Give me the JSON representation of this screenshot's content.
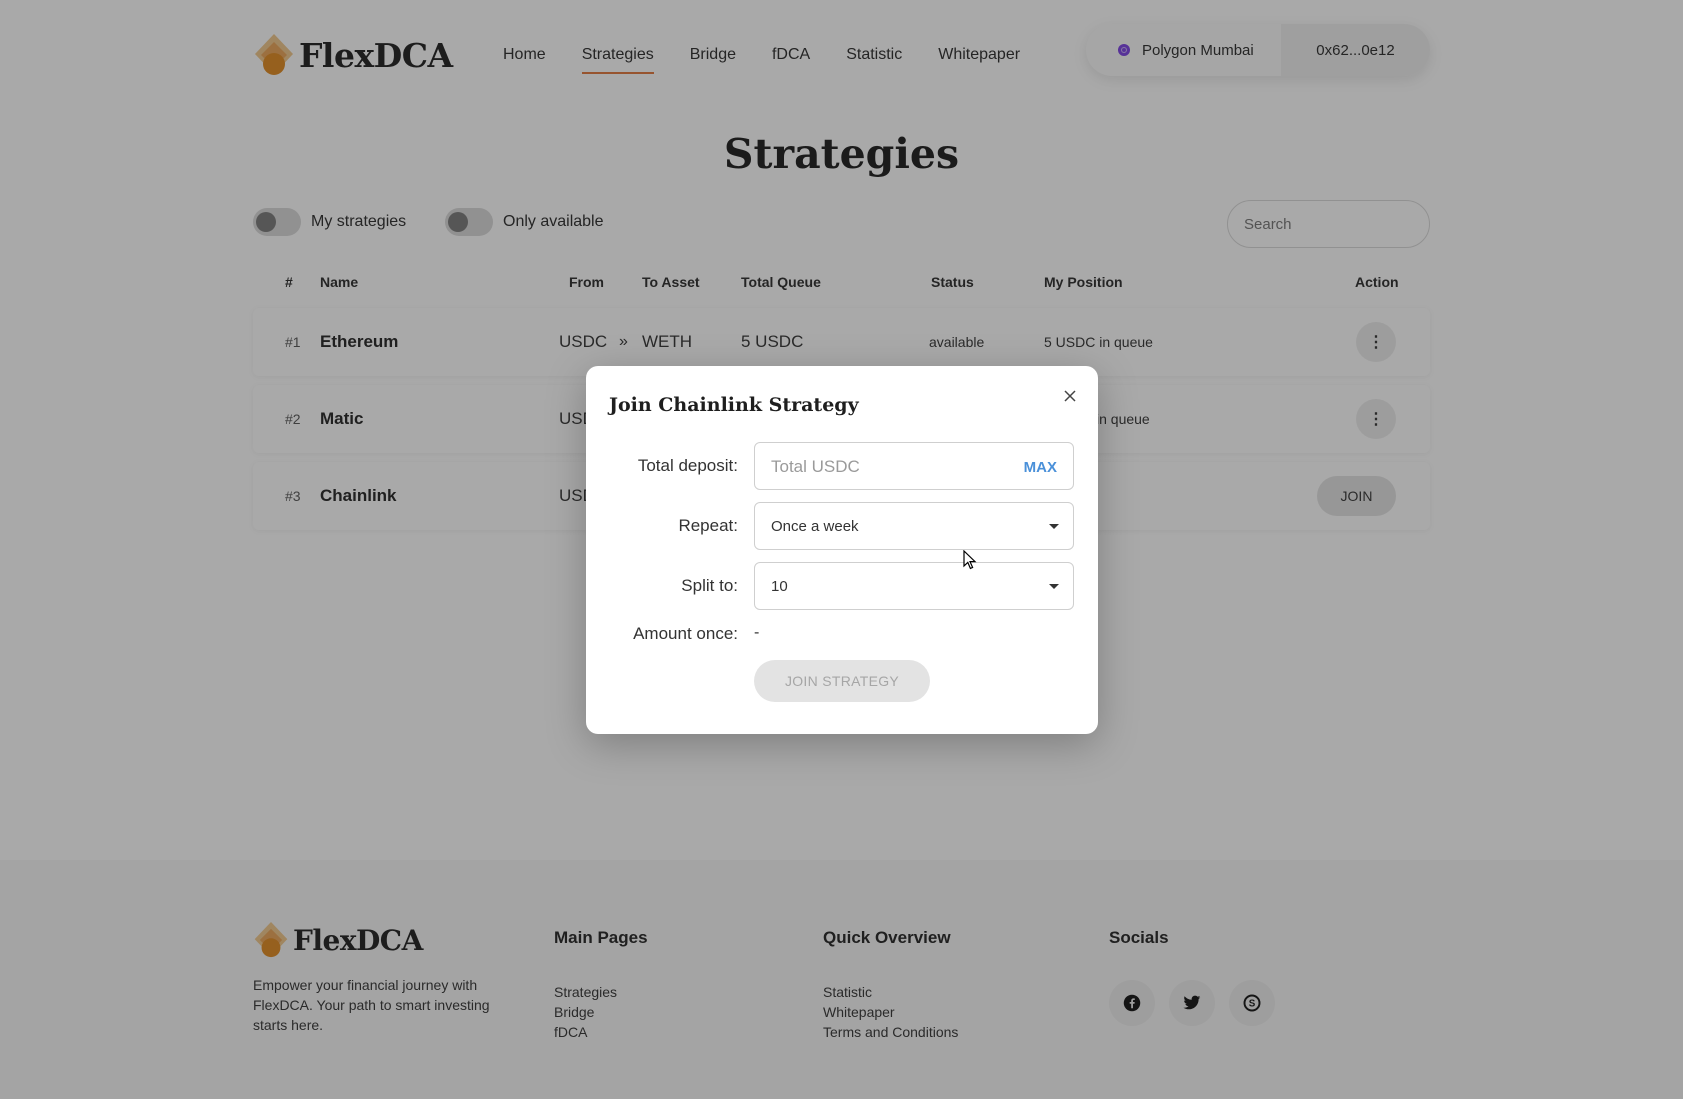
{
  "header": {
    "brand": "FlexDCA",
    "nav": [
      {
        "label": "Home",
        "active": false
      },
      {
        "label": "Strategies",
        "active": true
      },
      {
        "label": "Bridge",
        "active": false
      },
      {
        "label": "fDCA",
        "active": false
      },
      {
        "label": "Statistic",
        "active": false
      },
      {
        "label": "Whitepaper",
        "active": false
      }
    ],
    "network": "Polygon Mumbai",
    "address": "0x62...0e12"
  },
  "page_title": "Strategies",
  "filters": {
    "my_strategies": {
      "label": "My strategies",
      "on": false
    },
    "only_available": {
      "label": "Only available",
      "on": false
    },
    "search_placeholder": "Search"
  },
  "table": {
    "headers": {
      "num": "#",
      "name": "Name",
      "from": "From",
      "to": "To Asset",
      "queue": "Total Queue",
      "status": "Status",
      "position": "My Position",
      "action": "Action"
    },
    "rows": [
      {
        "num": "#1",
        "name": "Ethereum",
        "from": "USDC",
        "arrow": "»",
        "to": "WETH",
        "queue": "5 USDC",
        "status": "available",
        "position": "5 USDC in queue",
        "action": "menu"
      },
      {
        "num": "#2",
        "name": "Matic",
        "from": "USD",
        "arrow": "",
        "to": "",
        "queue": "",
        "status": "",
        "position": "in queue",
        "action": "menu"
      },
      {
        "num": "#3",
        "name": "Chainlink",
        "from": "USD",
        "arrow": "",
        "to": "",
        "queue": "",
        "status": "",
        "position": "",
        "action": "JOIN"
      }
    ]
  },
  "modal": {
    "title": "Join Chainlink Strategy",
    "total_deposit_label": "Total deposit:",
    "total_deposit_placeholder": "Total USDC",
    "max_label": "MAX",
    "repeat_label": "Repeat:",
    "repeat_value": "Once a week",
    "split_label": "Split to:",
    "split_value": "10",
    "amount_label": "Amount once:",
    "amount_value": "-",
    "submit_label": "JOIN STRATEGY"
  },
  "footer": {
    "brand": "FlexDCA",
    "description": "Empower your financial journey with FlexDCA. Your path to smart investing starts here.",
    "main_pages": {
      "title": "Main Pages",
      "links": [
        "Strategies",
        "Bridge",
        "fDCA"
      ]
    },
    "quick_overview": {
      "title": "Quick Overview",
      "links": [
        "Statistic",
        "Whitepaper",
        "Terms and Conditions"
      ]
    },
    "socials": {
      "title": "Socials",
      "icons": [
        "facebook-icon",
        "twitter-icon",
        "skype-icon"
      ]
    }
  },
  "colors": {
    "accent": "#e2763a",
    "link_max": "#4a90d9",
    "network_dot": "#7b3fe4"
  }
}
